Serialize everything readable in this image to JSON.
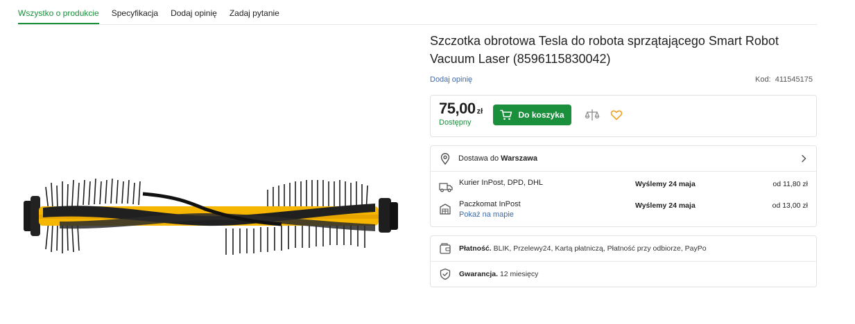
{
  "tabs": [
    {
      "label": "Wszystko o produkcie",
      "active": true
    },
    {
      "label": "Specyfikacja",
      "active": false
    },
    {
      "label": "Dodaj opinię",
      "active": false
    },
    {
      "label": "Zadaj pytanie",
      "active": false
    }
  ],
  "product": {
    "title": "Szczotka obrotowa Tesla do robota sprzątającego Smart Robot Vacuum Laser (8596115830042)",
    "add_review": "Dodaj opinię",
    "code_label": "Kod:",
    "code_value": "411545175",
    "image_alt": "rotating-brush-image"
  },
  "price": {
    "amount": "75,00",
    "currency": "zł",
    "availability": "Dostępny",
    "cart_button": "Do koszyka"
  },
  "delivery": {
    "prefix": "Dostawa do",
    "city": "Warszawa",
    "options": [
      {
        "name": "Kurier InPost, DPD, DHL",
        "date": "Wyślemy 24 maja",
        "price": "od 11,80 zł",
        "icon": "truck-icon"
      },
      {
        "name": "Paczkomat InPost",
        "link": "Pokaż na mapie",
        "date": "Wyślemy 24 maja",
        "price": "od 13,00 zł",
        "icon": "parcel-locker-icon"
      }
    ]
  },
  "payment": {
    "label": "Płatność.",
    "text": "BLIK, Przelewy24, Kartą płatniczą, Płatność przy odbiorze, PayPo"
  },
  "warranty": {
    "label": "Gwarancja.",
    "text": "12 miesięcy"
  },
  "colors": {
    "accent": "#1a8f3c",
    "link": "#3d6aa8",
    "heart": "#f0a020"
  }
}
